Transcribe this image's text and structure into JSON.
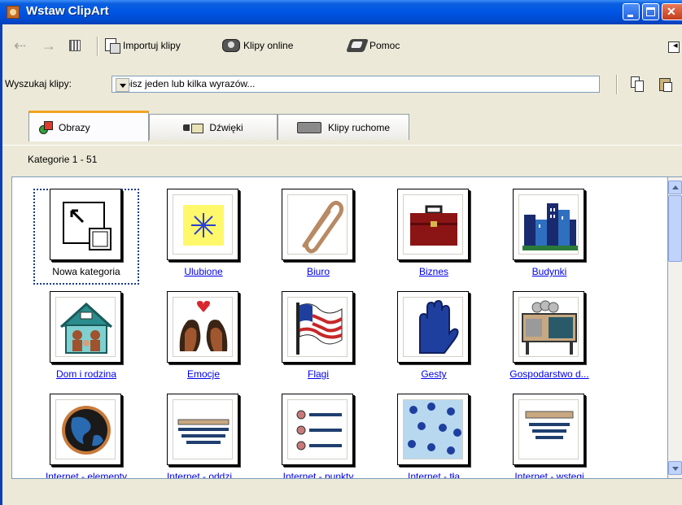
{
  "window": {
    "title": "Wstaw ClipArt"
  },
  "toolbar": {
    "import_label": "Importuj klipy",
    "online_label": "Klipy online",
    "help_label": "Pomoc"
  },
  "search": {
    "label": "Wyszukaj klipy:",
    "value": "Wpisz jeden lub kilka wyrazów..."
  },
  "tabs": [
    {
      "label": "Obrazy",
      "active": true
    },
    {
      "label": "Dźwięki",
      "active": false
    },
    {
      "label": "Klipy ruchome",
      "active": false
    }
  ],
  "category_count": "Kategorie 1 - 51",
  "categories": [
    {
      "label": "Nowa kategoria",
      "icon": "new-category-icon",
      "selected": true
    },
    {
      "label": "Ulubione",
      "icon": "star-note-icon"
    },
    {
      "label": "Biuro",
      "icon": "paperclip-icon"
    },
    {
      "label": "Biznes",
      "icon": "briefcase-icon"
    },
    {
      "label": "Budynki",
      "icon": "buildings-icon"
    },
    {
      "label": "Dom i rodzina",
      "icon": "house-family-icon"
    },
    {
      "label": "Emocje",
      "icon": "faces-heart-icon"
    },
    {
      "label": "Flagi",
      "icon": "flag-icon"
    },
    {
      "label": "Gesty",
      "icon": "hand-icon"
    },
    {
      "label": "Gospodarstwo d...",
      "icon": "appliances-icon"
    },
    {
      "label": "Internet - elementy",
      "icon": "globe-icon"
    },
    {
      "label": "Internet - oddzi...",
      "icon": "divider-icon"
    },
    {
      "label": "Internet - punkty",
      "icon": "bullets-icon"
    },
    {
      "label": "Internet - tła",
      "icon": "pattern-background-icon"
    },
    {
      "label": "Internet - wstęgi",
      "icon": "banner-icon"
    }
  ],
  "colors": {
    "titlebar": "#0055e5",
    "link": "#0000ee",
    "tab_active_accent": "#f3a31e"
  }
}
